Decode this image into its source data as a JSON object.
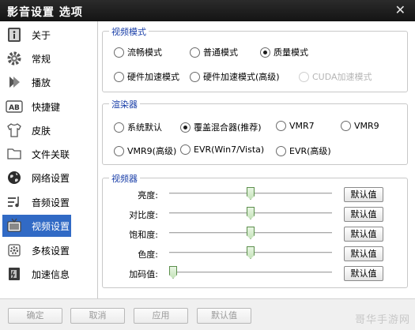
{
  "window": {
    "title": "影音设置 选项",
    "close_label": "✕"
  },
  "sidebar": {
    "items": [
      {
        "label": "关于",
        "icon": "info-icon"
      },
      {
        "label": "常规",
        "icon": "gear-icon"
      },
      {
        "label": "播放",
        "icon": "play-icon"
      },
      {
        "label": "快捷键",
        "icon": "keyboard-icon"
      },
      {
        "label": "皮肤",
        "icon": "shirt-icon"
      },
      {
        "label": "文件关联",
        "icon": "folder-icon"
      },
      {
        "label": "网络设置",
        "icon": "globe-icon"
      },
      {
        "label": "音频设置",
        "icon": "audio-icon"
      },
      {
        "label": "视频设置",
        "icon": "tv-icon",
        "active": true
      },
      {
        "label": "多核设置",
        "icon": "multicore-icon"
      },
      {
        "label": "加速信息",
        "icon": "speed-icon"
      }
    ]
  },
  "video_mode": {
    "title": "视频模式",
    "options": [
      {
        "label": "流畅模式",
        "checked": false,
        "disabled": false
      },
      {
        "label": "普通模式",
        "checked": false,
        "disabled": false
      },
      {
        "label": "质量模式",
        "checked": true,
        "disabled": false
      },
      {
        "label": "硬件加速模式",
        "checked": false,
        "disabled": false
      },
      {
        "label": "硬件加速模式(高级)",
        "checked": false,
        "disabled": false
      },
      {
        "label": "CUDA加速模式",
        "checked": false,
        "disabled": true
      }
    ]
  },
  "renderer": {
    "title": "渲染器",
    "options": [
      {
        "label": "系统默认",
        "checked": false
      },
      {
        "label": "覆盖混合器(推荐)",
        "checked": true
      },
      {
        "label": "VMR7",
        "checked": false
      },
      {
        "label": "VMR9",
        "checked": false
      },
      {
        "label": "VMR9(高级)",
        "checked": false
      },
      {
        "label": "EVR(Win7/Vista)",
        "checked": false
      },
      {
        "label": "EVR(高级)",
        "checked": false
      }
    ]
  },
  "video": {
    "title": "视频器",
    "default_label": "默认值",
    "sliders": [
      {
        "label": "亮度:",
        "value": 0.5
      },
      {
        "label": "对比度:",
        "value": 0.5
      },
      {
        "label": "饱和度:",
        "value": 0.5
      },
      {
        "label": "色度:",
        "value": 0.5
      },
      {
        "label": "加码值:",
        "value": 0.0
      }
    ]
  },
  "footer": {
    "ok_label": "确定",
    "cancel_label": "取消",
    "apply_label": "应用",
    "default_label": "默认值"
  },
  "watermark": "哥华手游网"
}
